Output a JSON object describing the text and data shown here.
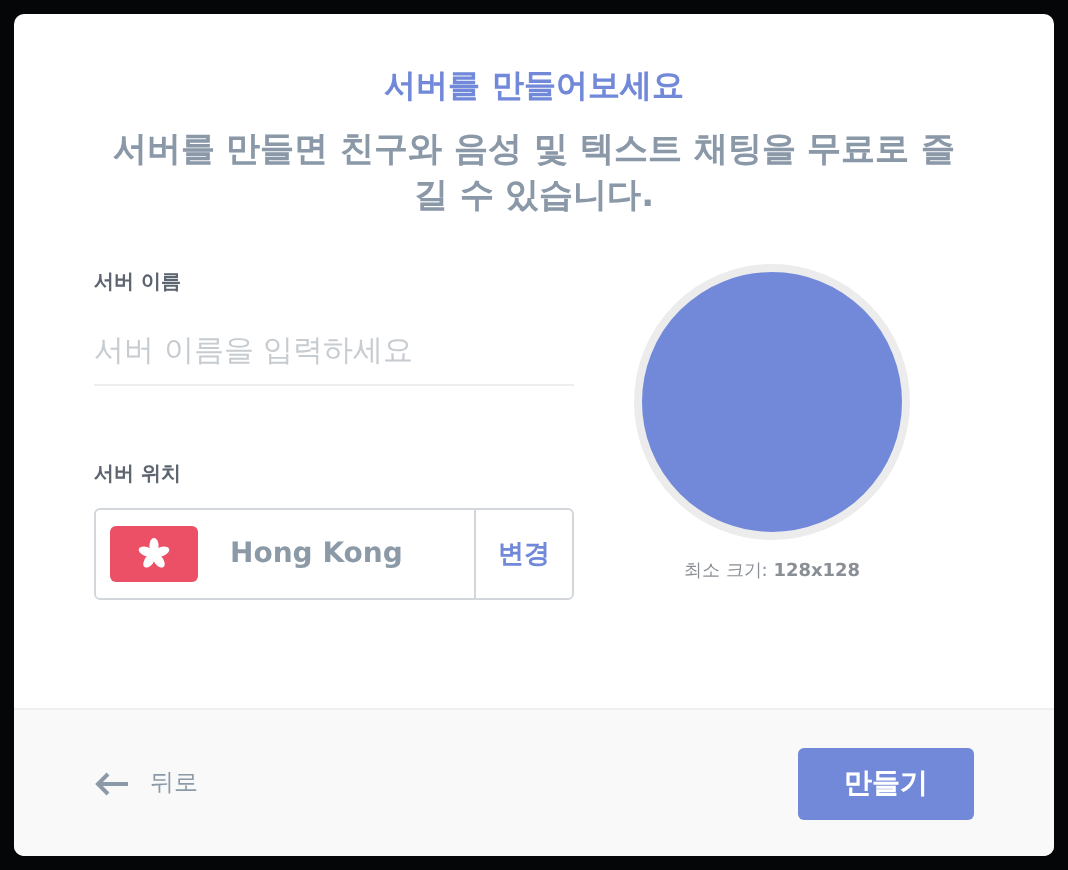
{
  "dialog": {
    "title": "서버를 만들어보세요",
    "subtitle": "서버를 만들면 친구와 음성 및 텍스트 채팅을 무료로 즐길 수 있습니다."
  },
  "server_name": {
    "label": "서버 이름",
    "placeholder": "서버 이름을 입력하세요"
  },
  "server_region": {
    "label": "서버 위치",
    "region": "Hong Kong",
    "change_button": "변경"
  },
  "icon_upload": {
    "caption": "최소 크기:",
    "size": "128x128"
  },
  "footer": {
    "back": "뒤로",
    "create_button": "만들기"
  }
}
